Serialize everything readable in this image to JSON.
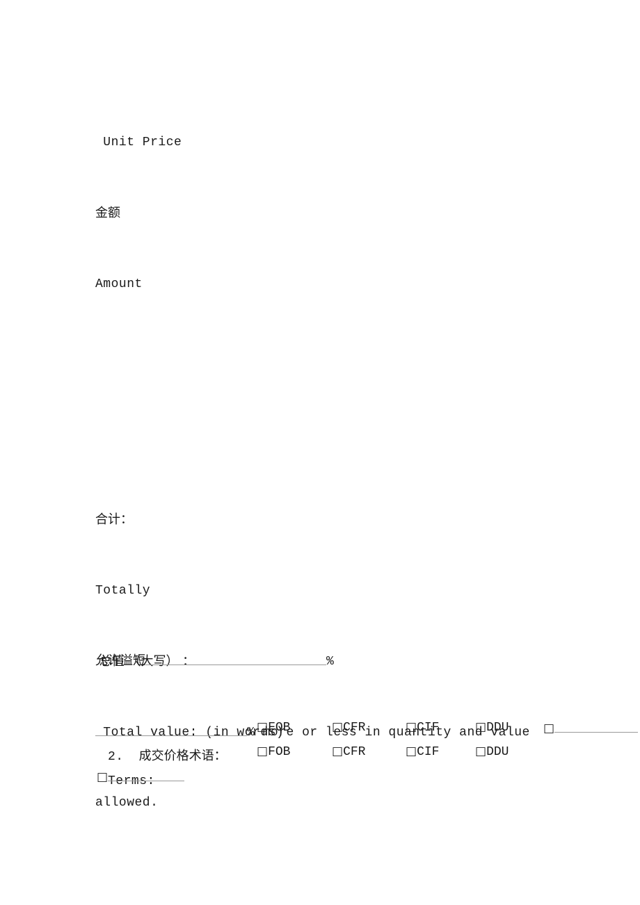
{
  "document": {
    "language_pair": "zh-en",
    "header_fields": {
      "unit_price_en": " Unit Price",
      "amount_zh": "金额",
      "amount_en": "Amount"
    },
    "totals": {
      "totally_zh": "合计：",
      "totally_en": "Totally",
      "total_value_zh": " 总值 （大写） ：",
      "total_value_en": " Total value: (in words)"
    },
    "tolerance": {
      "label_zh": "允许溢短",
      "percent_sign": "%",
      "text_en_part1": "% more or less in quantity and value",
      "text_en_part2": "allowed."
    },
    "price_terms": {
      "number": "2.",
      "label_zh": "成交价格术语：",
      "label_en": "Terms:",
      "checkbox_glyph": "□",
      "options_zh": [
        "FOB",
        "CFR",
        "CIF",
        "DDU"
      ],
      "options_en": [
        "FOB",
        "CFR",
        "CIF",
        "DDU"
      ],
      "other_option_label": ""
    }
  }
}
